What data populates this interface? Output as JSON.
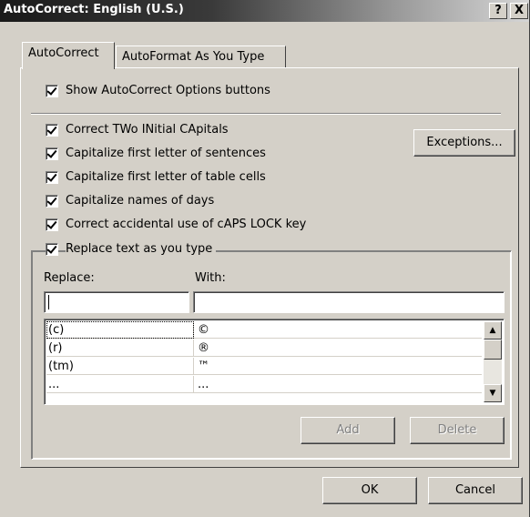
{
  "window": {
    "title": "AutoCorrect: English (U.S.)",
    "help_label": "?",
    "close_label": "X"
  },
  "tabs": [
    {
      "label": "AutoCorrect",
      "selected": true
    },
    {
      "label": "AutoFormat As You Type",
      "selected": false
    }
  ],
  "options": {
    "show_buttons": {
      "label": "Show AutoCorrect Options buttons",
      "checked": true
    },
    "correct_two_initial": {
      "label": "Correct TWo INitial CApitals",
      "checked": true
    },
    "capitalize_sentences": {
      "label": "Capitalize first letter of sentences",
      "checked": true
    },
    "capitalize_table_cells": {
      "label": "Capitalize first letter of table cells",
      "checked": true
    },
    "capitalize_days": {
      "label": "Capitalize names of days",
      "checked": true
    },
    "correct_caps_lock": {
      "label": "Correct accidental use of cAPS LOCK key",
      "checked": true
    },
    "replace_as_you_type": {
      "label": "Replace text as you type",
      "checked": true
    }
  },
  "buttons": {
    "exceptions": "Exceptions...",
    "add": "Add",
    "delete": "Delete",
    "ok": "OK",
    "cancel": "Cancel"
  },
  "replace": {
    "replace_label": "Replace:",
    "with_label": "With:",
    "replace_value": "",
    "with_value": ""
  },
  "list": {
    "rows": [
      {
        "replace": "(c)",
        "with": "©"
      },
      {
        "replace": "(r)",
        "with": "®"
      },
      {
        "replace": "(tm)",
        "with": "™"
      },
      {
        "replace": "...",
        "with": "..."
      }
    ]
  },
  "scrollbar": {
    "up_icon": "arrow-up",
    "down_icon": "arrow-down"
  }
}
